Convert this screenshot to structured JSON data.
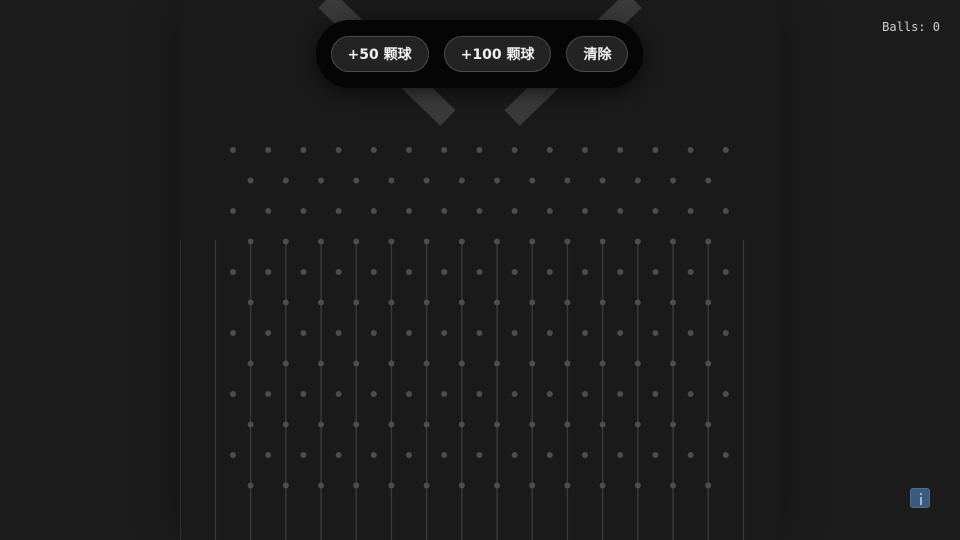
{
  "toolbar": {
    "add50_label": "+50 颗球",
    "add100_label": "+100 颗球",
    "clear_label": "清除"
  },
  "counter": {
    "label": "Balls:",
    "value": "0"
  },
  "board": {
    "peg_rows": 12,
    "pegs_per_wide_row": 15,
    "pegs_per_narrow_row": 14,
    "bins": 15
  },
  "colors": {
    "background": "#1c1c1c",
    "board": "#1a1a1a",
    "peg": "#4d4d4d",
    "divider": "#3a3a3a",
    "funnel": "#3a3a3a",
    "toolbar": "#050505",
    "button": "#232323",
    "button_border": "#4a4a4a",
    "info_accent": "#3c5a80"
  },
  "icons": {
    "info": "info-icon"
  }
}
